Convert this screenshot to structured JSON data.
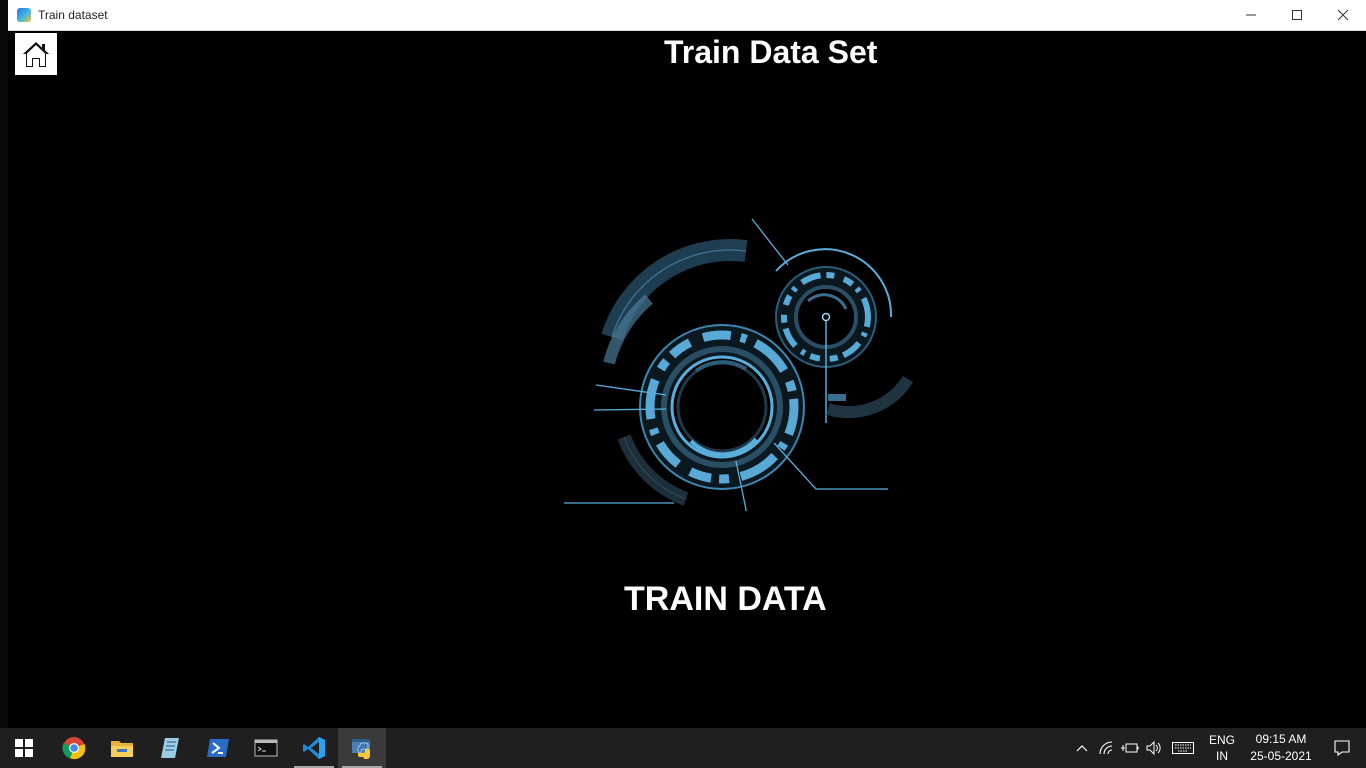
{
  "window": {
    "title": "Train dataset"
  },
  "page": {
    "heading": "Train Data Set",
    "graphic_label": "TRAIN DATA"
  },
  "taskbar": {
    "apps": [
      {
        "name": "start",
        "icon": "windows-logo-icon"
      },
      {
        "name": "chrome",
        "icon": "chrome-icon"
      },
      {
        "name": "file-explorer",
        "icon": "folder-icon"
      },
      {
        "name": "notepad",
        "icon": "notepad-icon"
      },
      {
        "name": "powershell",
        "icon": "powershell-icon"
      },
      {
        "name": "command-prompt",
        "icon": "terminal-icon"
      },
      {
        "name": "vscode",
        "icon": "vscode-icon"
      },
      {
        "name": "python",
        "icon": "python-icon"
      }
    ],
    "tray": {
      "language_top": "ENG",
      "language_bottom": "IN",
      "time": "09:15 AM",
      "date": "25-05-2021"
    }
  },
  "colors": {
    "accent_blue": "#5aaedc",
    "dark_blue": "#2c5d78",
    "taskbar": "#1f1f1f"
  }
}
